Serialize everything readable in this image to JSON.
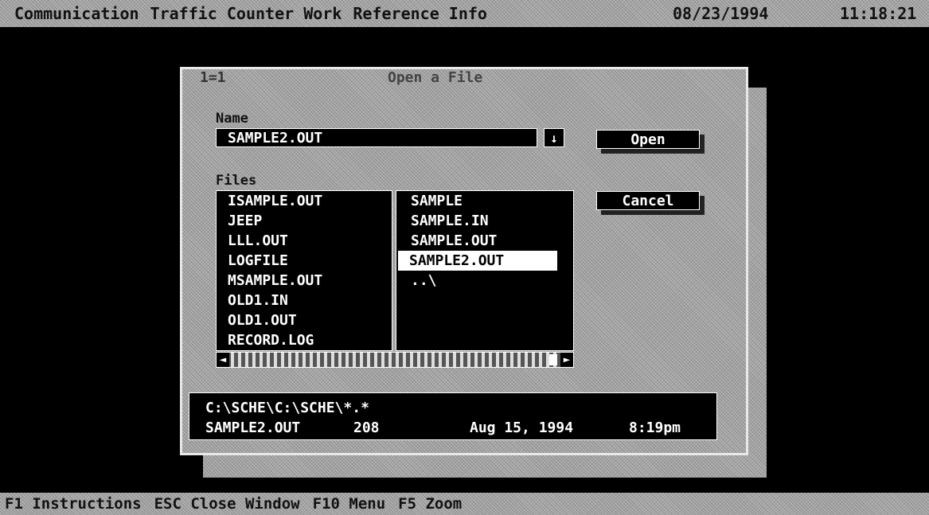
{
  "menubar": {
    "items": [
      "Communication",
      "Traffic Counter Work",
      "Reference Info"
    ],
    "date": "08/23/1994",
    "time": "11:18:21"
  },
  "dialog": {
    "number": "1=1",
    "title": "Open a File",
    "name_label": "Name",
    "name_value": "SAMPLE2.OUT",
    "dropdown_glyph": "↓",
    "files_label": "Files",
    "open_label": "Open",
    "cancel_label": "Cancel",
    "files_left": [
      "ISAMPLE.OUT",
      "JEEP",
      "LLL.OUT",
      "LOGFILE",
      "MSAMPLE.OUT",
      "OLD1.IN",
      "OLD1.OUT",
      "RECORD.LOG"
    ],
    "files_right": [
      "SAMPLE",
      "SAMPLE.IN",
      "SAMPLE.OUT",
      "SAMPLE2.OUT",
      "..\\"
    ],
    "selected_file": "SAMPLE2.OUT",
    "info": {
      "path": "C:\\SCHE\\C:\\SCHE\\*.*",
      "file": "SAMPLE2.OUT",
      "size": "208",
      "date": "Aug 15, 1994",
      "time": "8:19pm"
    }
  },
  "statusbar": {
    "items": [
      "F1 Instructions",
      "ESC Close Window",
      "F10 Menu",
      "F5 Zoom"
    ]
  }
}
